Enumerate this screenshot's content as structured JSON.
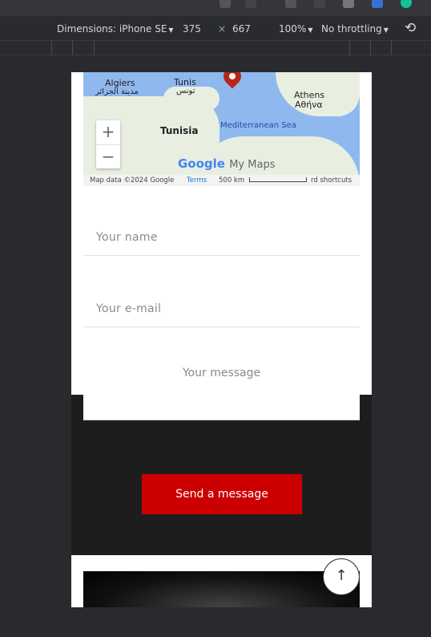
{
  "devtools": {
    "dimensions_label": "Dimensions: iPhone SE",
    "width": "375",
    "times": "×",
    "height": "667",
    "zoom": "100%",
    "throttling": "No throttling"
  },
  "map": {
    "labels": {
      "algiers": "Algiers",
      "algiers_ar": "مدينة الجزائر",
      "tunis": "Tunis",
      "tunis_ar": "تونس",
      "tunisia": "Tunisia",
      "athens": "Athens",
      "athens_gr": "Αθήνα",
      "sea": "Mediterranean Sea"
    },
    "zoom_in": "+",
    "zoom_out": "−",
    "brand_google": "Google",
    "brand_mymaps": "My Maps",
    "attribution": "Map data ©2024 Google",
    "terms": "Terms",
    "scale": "500 km",
    "shortcuts": "rd shortcuts"
  },
  "form": {
    "name_placeholder": "Your name",
    "email_placeholder": "Your e-mail",
    "message_placeholder": "Your message",
    "submit": "Send a message"
  },
  "scroll_top_icon": "arrow-up-icon"
}
